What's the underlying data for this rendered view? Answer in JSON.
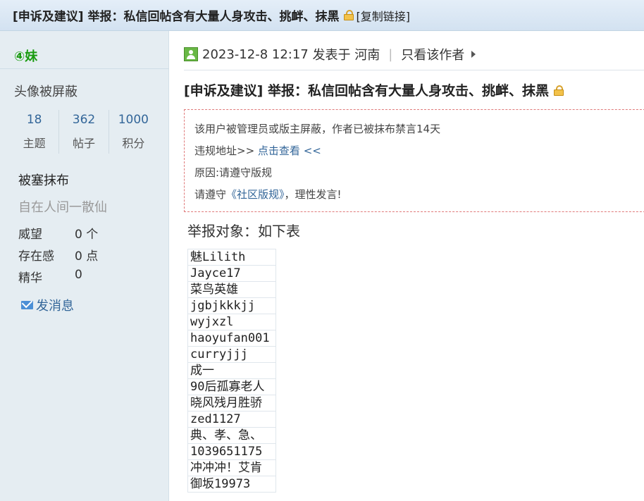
{
  "header": {
    "title": "[申诉及建议] 举报：私信回帖含有大量人身攻击、挑衅、抹黑",
    "copy_link": "[复制链接]"
  },
  "sidebar": {
    "username": "④妹",
    "avatar_status": "头像被屏蔽",
    "stats": [
      {
        "value": "18",
        "label": "主题"
      },
      {
        "value": "362",
        "label": "帖子"
      },
      {
        "value": "1000",
        "label": "积分"
      }
    ],
    "user_group": "被塞抹布",
    "signature": "自在人间一散仙",
    "properties": [
      {
        "label": "威望",
        "value": "0 个"
      },
      {
        "label": "存在感",
        "value": "0 点"
      },
      {
        "label": "精华",
        "value": "0"
      }
    ],
    "send_message": "发消息"
  },
  "post": {
    "date": "2023-12-8 12:17",
    "posted_in": "发表于 河南",
    "author_only": "只看该作者",
    "title": "[申诉及建议] 举报：私信回帖含有大量人身攻击、挑衅、抹黑",
    "notice": {
      "blocked": "该用户被管理员或版主屏蔽，作者已被抹布禁言14天",
      "violation_prefix": "违规地址>> ",
      "violation_link": "点击查看",
      "violation_suffix": " <<",
      "reason": "原因:请遵守版规",
      "rules_prefix": "请遵守",
      "rules_link": "《社区版规》",
      "rules_suffix": "，理性发言!"
    },
    "target_label": "举报对象：如下表",
    "targets": [
      "魅Lilith",
      "Jayce17",
      "菜鸟英雄",
      "jgbjkkkjj",
      "wyjxzl",
      "haoyufan001",
      "curryjjj",
      "成一",
      "90后孤寡老人",
      "晓风残月胜骄",
      "zed1127",
      "典、孝、急、",
      " 1039651175",
      "冲冲冲！艾肯",
      "御坂19973"
    ]
  }
}
